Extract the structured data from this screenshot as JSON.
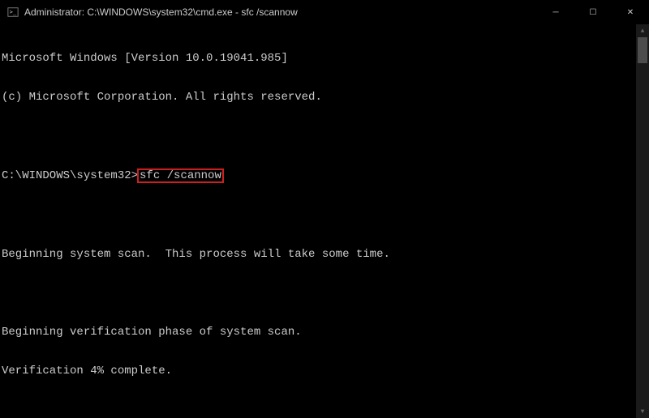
{
  "titlebar": {
    "title": "Administrator: C:\\WINDOWS\\system32\\cmd.exe - sfc  /scannow"
  },
  "window_controls": {
    "minimize": "─",
    "maximize": "☐",
    "close": "✕"
  },
  "terminal": {
    "line1": "Microsoft Windows [Version 10.0.19041.985]",
    "line2": "(c) Microsoft Corporation. All rights reserved.",
    "prompt": "C:\\WINDOWS\\system32>",
    "command": "sfc /scannow",
    "line_scan": "Beginning system scan.  This process will take some time.",
    "line_verify": "Beginning verification phase of system scan.",
    "line_progress": "Verification 4% complete."
  },
  "scroll": {
    "up": "▲",
    "down": "▼"
  }
}
